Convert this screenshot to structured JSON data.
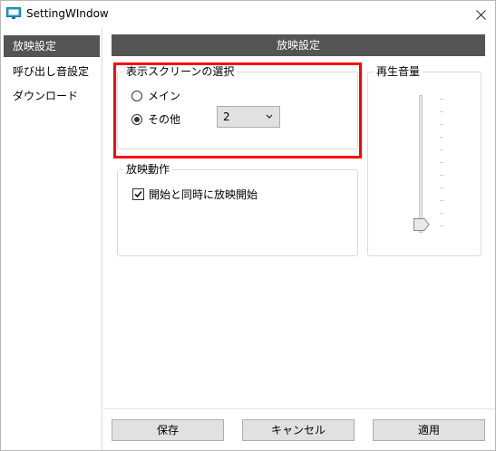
{
  "window": {
    "title": "SettingWIndow"
  },
  "sidebar": {
    "items": [
      {
        "label": "放映設定",
        "active": true
      },
      {
        "label": "呼び出し音設定",
        "active": false
      },
      {
        "label": "ダウンロード",
        "active": false
      }
    ]
  },
  "main": {
    "header": "放映設定",
    "display_group": {
      "legend": "表示スクリーンの選択",
      "option_main": "メイン",
      "option_other": "その他",
      "selected_option": "その他",
      "screen_select_value": "2"
    },
    "playback_group": {
      "legend": "放映動作",
      "auto_start_label": "開始と同時に放映開始",
      "auto_start_checked": true
    },
    "volume_group": {
      "legend": "再生音量",
      "volume_level_fraction": 0.0
    }
  },
  "footer": {
    "save_label": "保存",
    "cancel_label": "キャンセル",
    "apply_label": "適用"
  },
  "colors": {
    "header_bg": "#545454",
    "highlight": "#ff0000",
    "button_bg": "#e1e1e1"
  },
  "icons": {
    "app": "monitor-icon",
    "close": "close-icon",
    "dropdown": "chevron-down-icon",
    "check": "check-icon"
  }
}
